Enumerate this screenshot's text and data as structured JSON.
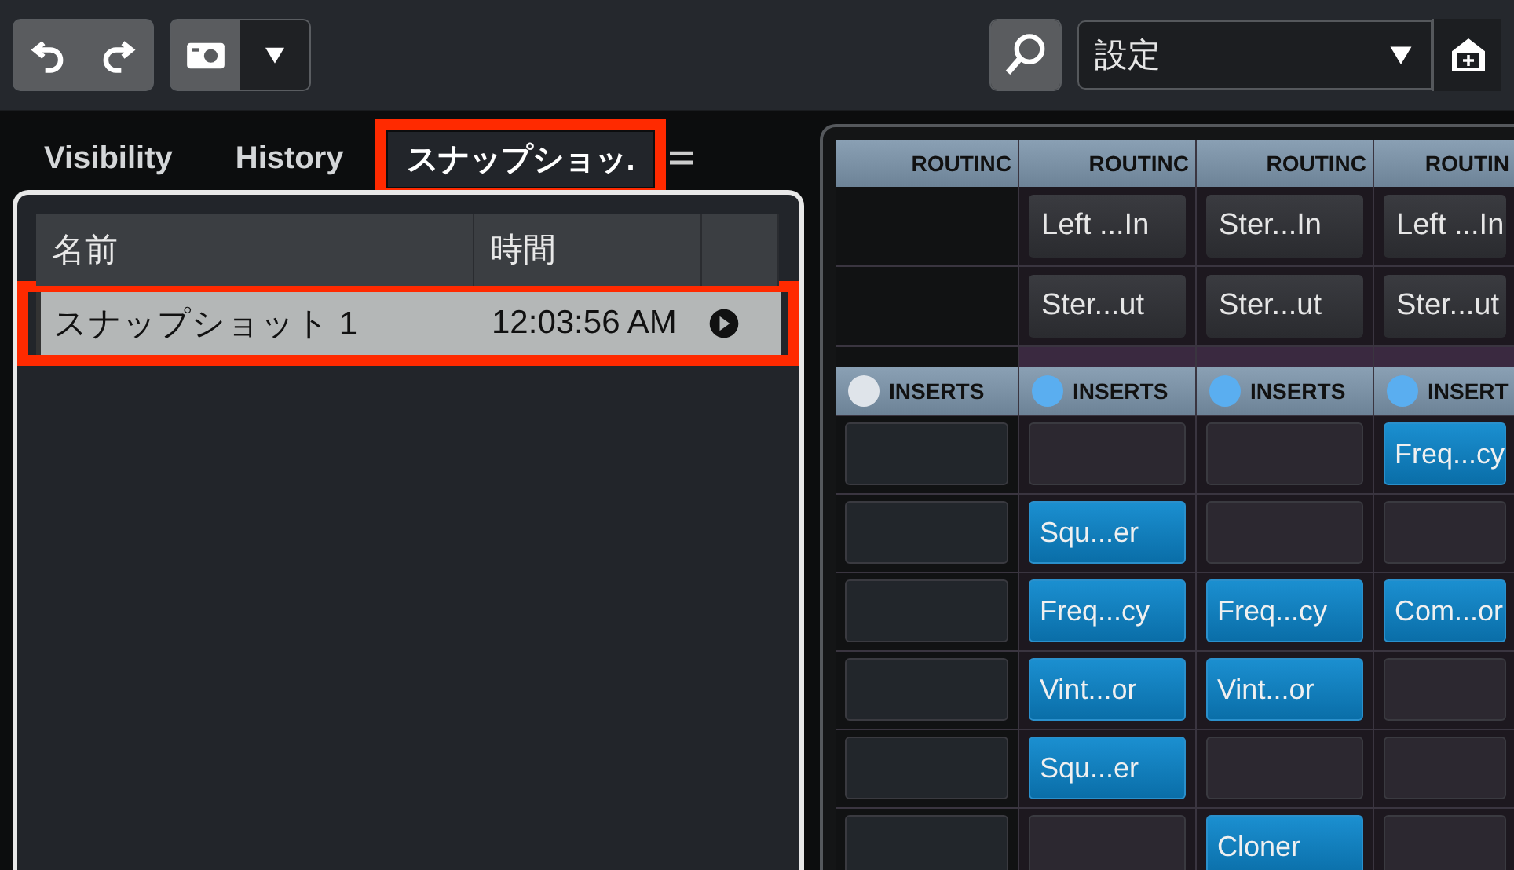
{
  "toolbar": {
    "preset": {
      "value": "設定"
    }
  },
  "tabs": [
    {
      "label": "Visibility",
      "selected": false,
      "highlighted": false
    },
    {
      "label": "History",
      "selected": false,
      "highlighted": false
    },
    {
      "label": "スナップショッ.",
      "selected": true,
      "highlighted": true
    }
  ],
  "table": {
    "columns": [
      "名前",
      "時間"
    ],
    "rows": [
      {
        "name": "スナップショット 1",
        "time": "12:03:56 AM",
        "selected": true,
        "highlighted": true
      }
    ]
  },
  "mixer": {
    "columns": [
      {
        "kind": "plain",
        "routing_header": "ROUTINC",
        "inserts_header": "INSERTS",
        "color": "#dfe4ea",
        "inserts": [
          {
            "filled": false
          },
          {
            "filled": false
          },
          {
            "filled": false
          },
          {
            "filled": false
          },
          {
            "filled": false
          },
          {
            "filled": false
          }
        ]
      },
      {
        "kind": "tinted",
        "routing_header": "ROUTINC",
        "inserts_header": "INSERTS",
        "color": "#5aaef0",
        "routing": [
          "Left ...In",
          "Ster...ut"
        ],
        "inserts": [
          {
            "filled": false
          },
          {
            "filled": true,
            "name": "Squ...er"
          },
          {
            "filled": true,
            "name": "Freq...cy"
          },
          {
            "filled": true,
            "name": "Vint...or"
          },
          {
            "filled": true,
            "name": "Squ...er"
          },
          {
            "filled": false
          }
        ]
      },
      {
        "kind": "tinted",
        "routing_header": "ROUTINC",
        "inserts_header": "INSERTS",
        "color": "#5aaef0",
        "routing": [
          "Ster...In",
          "Ster...ut"
        ],
        "inserts": [
          {
            "filled": false
          },
          {
            "filled": false
          },
          {
            "filled": true,
            "name": "Freq...cy"
          },
          {
            "filled": true,
            "name": "Vint...or"
          },
          {
            "filled": false
          },
          {
            "filled": true,
            "name": "Cloner"
          }
        ]
      },
      {
        "kind": "tinted",
        "routing_header": "ROUTIN",
        "inserts_header": "INSERT",
        "color": "#5aaef0",
        "routing": [
          "Left ...In",
          "Ster...ut"
        ],
        "inserts": [
          {
            "filled": true,
            "name": "Freq...cy"
          },
          {
            "filled": false
          },
          {
            "filled": true,
            "name": "Com...or"
          },
          {
            "filled": false
          },
          {
            "filled": false
          },
          {
            "filled": false
          }
        ]
      }
    ]
  }
}
